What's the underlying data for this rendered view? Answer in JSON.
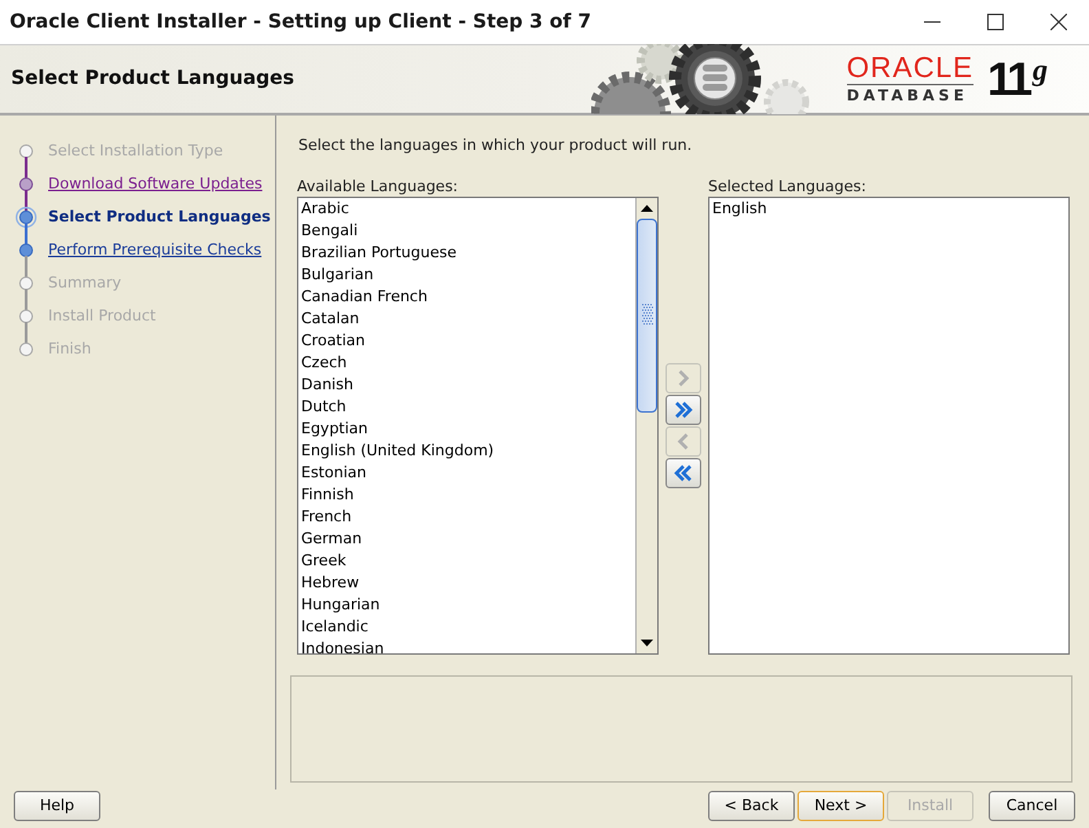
{
  "window": {
    "title": "Oracle Client Installer - Setting up Client - Step 3 of 7"
  },
  "header": {
    "title": "Select Product Languages",
    "logo_brand": "ORACLE",
    "logo_product": "DATABASE",
    "logo_version": "11",
    "logo_suffix": "g"
  },
  "steps": [
    {
      "label": "Select Installation Type",
      "kind": "disabled"
    },
    {
      "label": "Download Software Updates",
      "kind": "visited"
    },
    {
      "label": "Select Product Languages",
      "kind": "current"
    },
    {
      "label": "Perform Prerequisite Checks",
      "kind": "link"
    },
    {
      "label": "Summary",
      "kind": "disabled"
    },
    {
      "label": "Install Product",
      "kind": "disabled"
    },
    {
      "label": "Finish",
      "kind": "disabled"
    }
  ],
  "instruction": "Select the languages in which your product will run.",
  "available": {
    "label": "Available Languages:",
    "items": [
      "Arabic",
      "Bengali",
      "Brazilian Portuguese",
      "Bulgarian",
      "Canadian French",
      "Catalan",
      "Croatian",
      "Czech",
      "Danish",
      "Dutch",
      "Egyptian",
      "English (United Kingdom)",
      "Estonian",
      "Finnish",
      "French",
      "German",
      "Greek",
      "Hebrew",
      "Hungarian",
      "Icelandic",
      "Indonesian"
    ]
  },
  "move_buttons": [
    {
      "kind": "add",
      "disabled": true
    },
    {
      "kind": "add_all",
      "disabled": false
    },
    {
      "kind": "remove",
      "disabled": true
    },
    {
      "kind": "remove_all",
      "disabled": false
    }
  ],
  "selected": {
    "label": "Selected Languages:",
    "items": [
      "English"
    ]
  },
  "buttons": [
    {
      "label": "Help",
      "disabled": false,
      "focused": false
    },
    {
      "label": "< Back",
      "disabled": false,
      "focused": false
    },
    {
      "label": "Next >",
      "disabled": false,
      "focused": true
    },
    {
      "label": "Install",
      "disabled": true,
      "focused": false
    },
    {
      "label": "Cancel",
      "disabled": false,
      "focused": false
    }
  ]
}
